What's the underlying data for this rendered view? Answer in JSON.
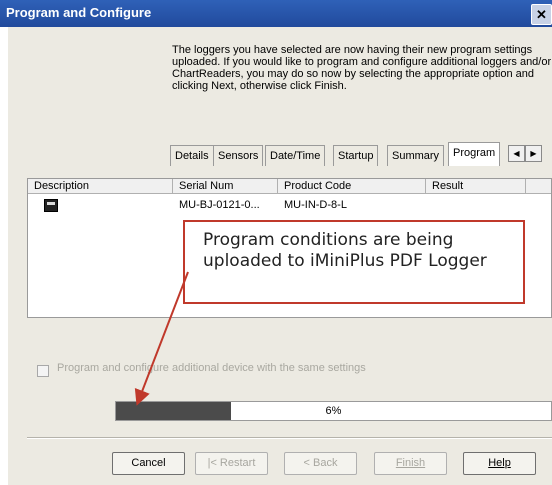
{
  "window": {
    "title": "Program and Configure",
    "close_label": "✕"
  },
  "intro_text": "The loggers you have selected are now having their new program settings uploaded. If you would like to program and configure additional loggers and/or ChartReaders, you may do so now by selecting the appropriate option and clicking Next, otherwise click Finish.",
  "tabs": [
    "Details",
    "Sensors",
    "Date/Time",
    "Startup",
    "Summary",
    "Program"
  ],
  "active_tab": "Program",
  "tab_scroll": {
    "left": "◀",
    "right": "▶"
  },
  "table": {
    "columns": [
      "Description",
      "Serial Num",
      "Product Code",
      "Result"
    ],
    "rows": [
      {
        "description_icon": "logger-device-icon",
        "serial": "MU-BJ-0121-0...",
        "product_code": "MU-IN-D-8-L",
        "result": ""
      }
    ]
  },
  "callout_text": "Program conditions are being uploaded to iMiniPlus PDF Logger",
  "checkbox": {
    "label": "Program and configure additional device with the same settings",
    "checked": false,
    "enabled": false
  },
  "progress": {
    "value": 0.06,
    "label": "6%"
  },
  "buttons": {
    "cancel": "Cancel",
    "restart": "|< Restart",
    "back": "< Back",
    "finish": "Finish",
    "help": "Help"
  },
  "colors": {
    "title_bar": "#2556ad",
    "callout_border": "#c0392b",
    "progress_fill": "#4b4b4b"
  }
}
